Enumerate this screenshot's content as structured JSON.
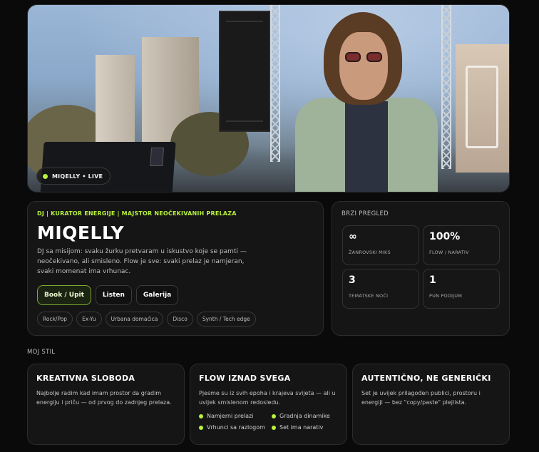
{
  "hero": {
    "badge": "MIQELLY • LIVE",
    "accent": "#b9f23c"
  },
  "profile": {
    "kicker": "DJ | KURATOR ENERGIJE | MAJSTOR NEOČEKIVANIH PRELAZA",
    "name": "MIQELLY",
    "description": "DJ sa misijom: svaku žurku pretvaram u iskustvo koje se pamti — neočekivano, ali smisleno. Flow je sve: svaki prelaz je namjeran, svaki momenat ima vrhunac.",
    "buttons": {
      "book": "Book / Upit",
      "listen": "Listen",
      "gallery": "Galerija"
    },
    "tags": [
      "Rock/Pop",
      "Ex-Yu",
      "Urbana domaćica",
      "Disco",
      "Synth / Tech edge"
    ]
  },
  "quick_overview": {
    "title": "BRZI PREGLED",
    "stats": [
      {
        "value": "∞",
        "label": "ŽANROVSKI MIKS"
      },
      {
        "value": "100%",
        "label": "FLOW / NARATIV"
      },
      {
        "value": "3",
        "label": "TEMATSKE NOĆI"
      },
      {
        "value": "1",
        "label": "PUN PODIJUM"
      }
    ]
  },
  "style": {
    "title": "MOJ STIL",
    "cards": [
      {
        "title": "KREATIVNA SLOBODA",
        "text": "Najbolje radim kad imam prostor da gradim energiju i priču — od prvog do zadnjeg prelaza."
      },
      {
        "title": "FLOW IZNAD SVEGA",
        "text": "Pjesme su iz svih epoha i krajeva svijeta — ali u uvijek smislenom redosledu.",
        "bullets": [
          "Namjerni prelazi",
          "Gradnja dinamike",
          "Vrhunci sa razlogom",
          "Set ima narativ"
        ]
      },
      {
        "title": "AUTENTIČNO, NE GENERIČKI",
        "text": "Set je uvijek prilagođen publici, prostoru i energiji — bez \"copy/paste\" plejlista."
      }
    ]
  }
}
